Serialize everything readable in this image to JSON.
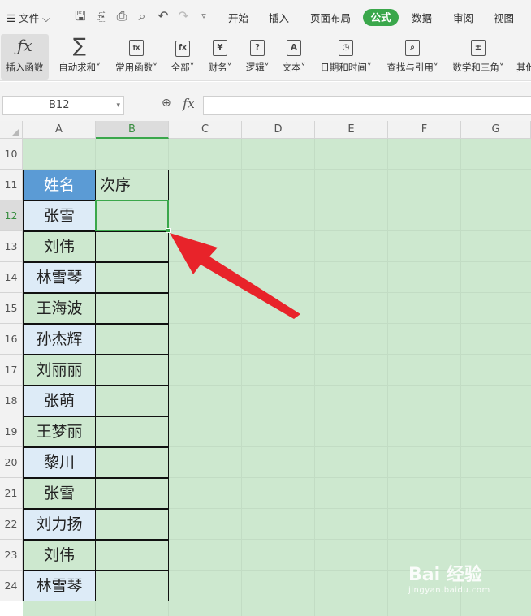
{
  "menubar": {
    "file": "文件",
    "tabs": [
      "开始",
      "插入",
      "页面布局",
      "公式",
      "数据",
      "审阅",
      "视图"
    ],
    "active_tab": "公式"
  },
  "ribbon": {
    "buttons": [
      {
        "label": "插入函数",
        "icon": "fx-icon"
      },
      {
        "label": "自动求和",
        "icon": "sigma-icon"
      },
      {
        "label": "常用函数",
        "icon": "common-func-icon"
      },
      {
        "label": "全部",
        "icon": "all-func-icon"
      },
      {
        "label": "财务",
        "icon": "finance-icon"
      },
      {
        "label": "逻辑",
        "icon": "logic-icon"
      },
      {
        "label": "文本",
        "icon": "text-func-icon"
      },
      {
        "label": "日期和时间",
        "icon": "datetime-icon"
      },
      {
        "label": "查找与引用",
        "icon": "lookup-icon"
      },
      {
        "label": "数学和三角",
        "icon": "math-icon"
      },
      {
        "label": "其他",
        "icon": "other-icon"
      }
    ]
  },
  "formula_bar": {
    "name_box": "B12",
    "fx_label": "fx",
    "formula": ""
  },
  "grid": {
    "columns": [
      "A",
      "B",
      "C",
      "D",
      "E",
      "F",
      "G"
    ],
    "selected_column": "B",
    "rows": [
      "10",
      "11",
      "12",
      "13",
      "14",
      "15",
      "16",
      "17",
      "18",
      "19",
      "20",
      "21",
      "22",
      "23",
      "24"
    ],
    "selected_row": "12",
    "table_header": {
      "name": "姓名",
      "order": "次序"
    },
    "names": [
      "张雪",
      "刘伟",
      "林雪琴",
      "王海波",
      "孙杰辉",
      "刘丽丽",
      "张萌",
      "王梦丽",
      "黎川",
      "张雪",
      "刘力扬",
      "刘伟",
      "林雪琴"
    ]
  },
  "watermark": {
    "brand": "Bai 经验",
    "url": "jingyan.baidu.com"
  },
  "colors": {
    "accent": "#3aa74b",
    "sheet_bg": "#cde8cf",
    "header_blue": "#5b9bd5",
    "row_blue": "#ddebf7",
    "arrow": "#e8232a"
  }
}
